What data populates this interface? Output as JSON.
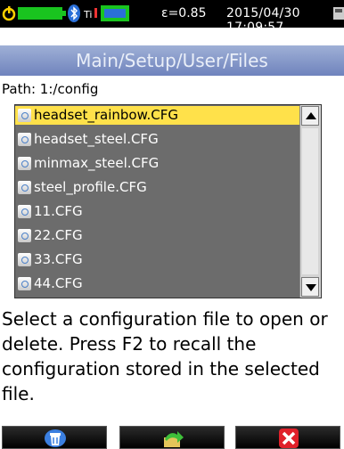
{
  "statusbar": {
    "emissivity": "ε=0.85",
    "datetime": "2015/04/30 17:09:57",
    "icons": [
      "power-icon",
      "battery-icon",
      "bluetooth-icon",
      "thermometer-icon",
      "sd-card-icon",
      "memory-icon"
    ]
  },
  "title": "Main/Setup/User/Files",
  "path": {
    "label": "Path:",
    "value": "1:/config"
  },
  "files": [
    "headset_rainbow.CFG",
    "headset_steel.CFG",
    "minmax_steel.CFG",
    "steel_profile.CFG",
    "11.CFG",
    "22.CFG",
    "33.CFG",
    "44.CFG"
  ],
  "selected_index": 0,
  "help_text": "Select a configuration file to open or delete. Press F2 to recall the configuration stored in the selected file.",
  "buttons": [
    {
      "name": "delete-button",
      "icon": "trash-icon"
    },
    {
      "name": "open-button",
      "icon": "load-arrow-icon"
    },
    {
      "name": "cancel-button",
      "icon": "close-icon"
    }
  ],
  "colors": {
    "selection": "#ffe14a",
    "list_bg": "#6c6c6c",
    "title_bg": "#8a9cc9"
  }
}
